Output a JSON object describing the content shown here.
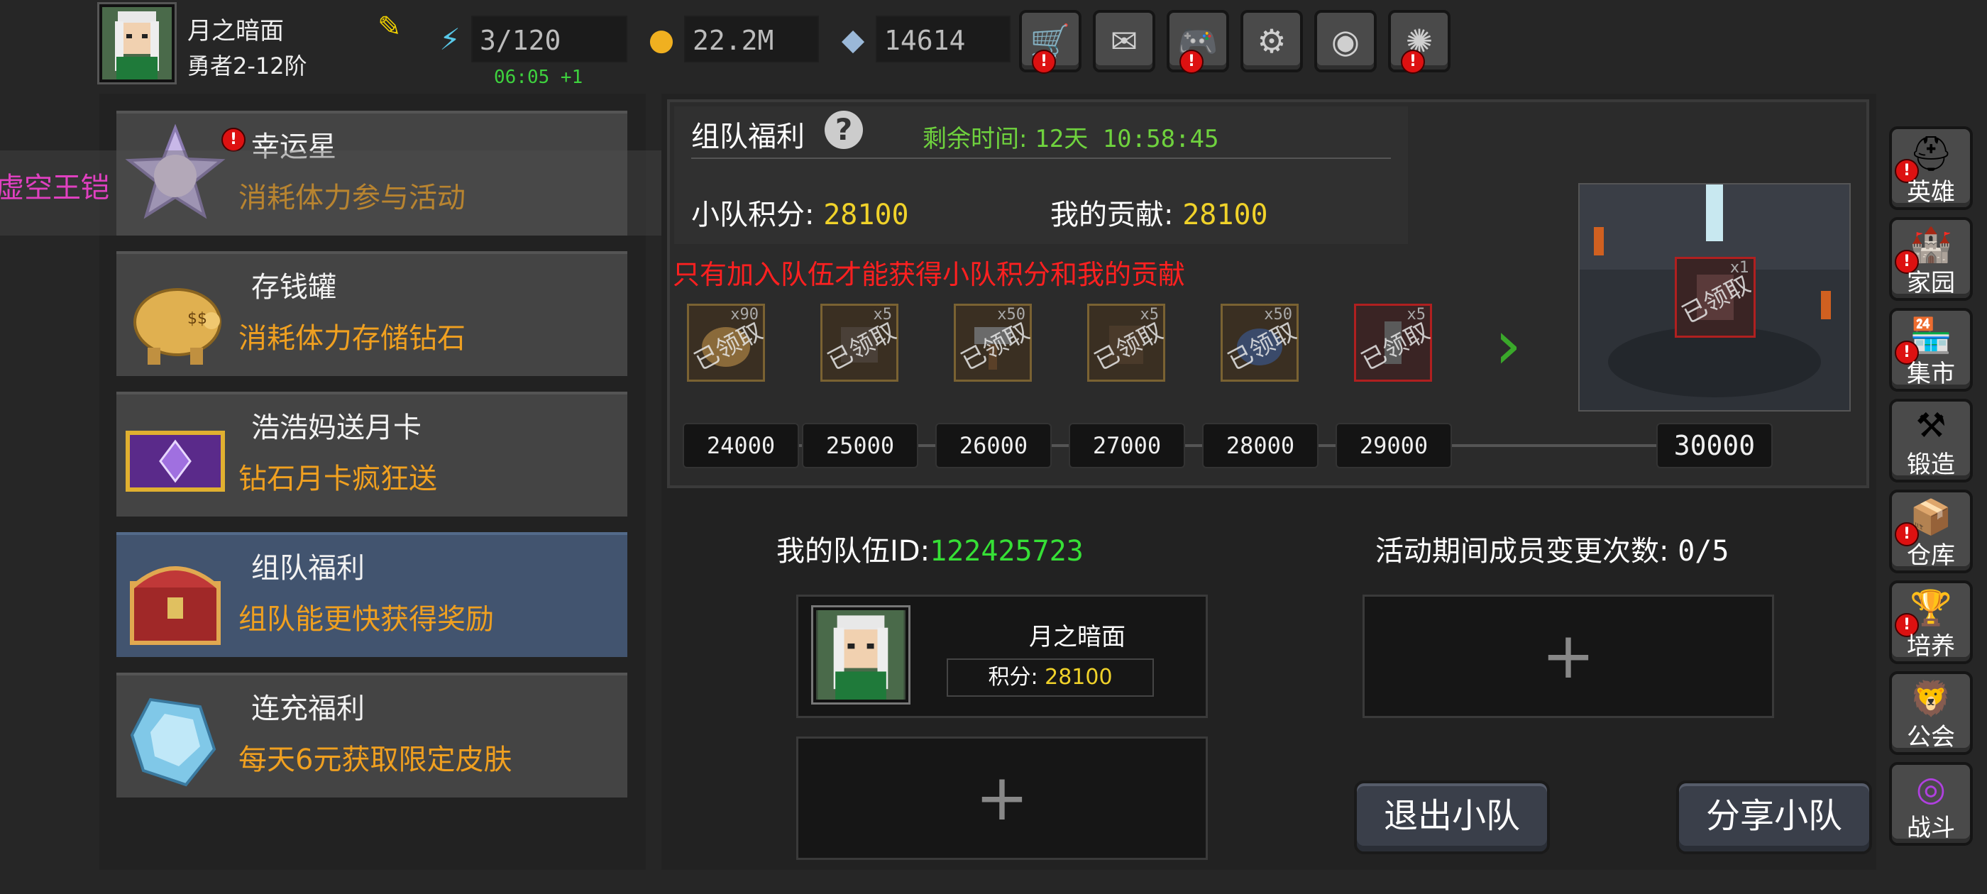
{
  "player": {
    "name": "月之暗面",
    "rank": "勇者2-12阶",
    "stamina": "3/120",
    "stamina_timer": "06:05 +1",
    "gold": "22.2M",
    "diamonds": "14614"
  },
  "top_icons": [
    "shop-cart-icon",
    "mail-icon",
    "gamepad-icon",
    "gear-icon",
    "color-wheel-icon",
    "firework-icon"
  ],
  "banner": {
    "text": "虚空王铠"
  },
  "events": [
    {
      "title": "幸运星",
      "subtitle": "消耗体力参与活动"
    },
    {
      "title": "存钱罐",
      "subtitle": "消耗体力存储钻石"
    },
    {
      "title": "浩浩妈送月卡",
      "subtitle": "钻石月卡疯狂送"
    },
    {
      "title": "组队福利",
      "subtitle": "组队能更快获得奖励"
    },
    {
      "title": "连充福利",
      "subtitle": "每天6元获取限定皮肤"
    }
  ],
  "team_reward": {
    "title": "组队福利",
    "remaining_label": "剩余时间:",
    "remaining_value": "12天 10:58:45",
    "team_score_label": "小队积分:",
    "team_score": "28100",
    "contribution_label": "我的贡献:",
    "contribution": "28100",
    "warning": "只有加入队伍才能获得小队积分和我的贡献",
    "claimed_label": "已领取",
    "rewards": [
      {
        "count": "x90",
        "threshold": "24000"
      },
      {
        "count": "x5",
        "threshold": "25000"
      },
      {
        "count": "x50",
        "threshold": "26000"
      },
      {
        "count": "x5",
        "threshold": "27000"
      },
      {
        "count": "x50",
        "threshold": "28000"
      },
      {
        "count": "x5",
        "threshold": "29000"
      }
    ],
    "final_reward": {
      "count": "x1",
      "threshold": "30000"
    }
  },
  "team": {
    "id_label": "我的队伍ID:",
    "id": "122425723",
    "changes_label": "活动期间成员变更次数:",
    "changes": "0/5",
    "member": {
      "name": "月之暗面",
      "score_label": "积分:",
      "score": "28100"
    },
    "empty_slot": "+",
    "quit_button": "退出小队",
    "share_button": "分享小队"
  },
  "sidebar": [
    {
      "label": "英雄",
      "icon": "helmet-icon"
    },
    {
      "label": "家园",
      "icon": "castle-icon"
    },
    {
      "label": "集市",
      "icon": "market-icon"
    },
    {
      "label": "锻造",
      "icon": "anvil-icon"
    },
    {
      "label": "仓库",
      "icon": "warehouse-icon"
    },
    {
      "label": "培养",
      "icon": "chalice-icon"
    },
    {
      "label": "公会",
      "icon": "guild-icon"
    },
    {
      "label": "战斗",
      "icon": "portal-icon"
    }
  ],
  "colors": {
    "accent_orange": "#f0a020",
    "score_yellow": "#f0d22a",
    "id_green": "#36e036",
    "warning_red": "#ff2020",
    "selected_card": "#42546f"
  }
}
